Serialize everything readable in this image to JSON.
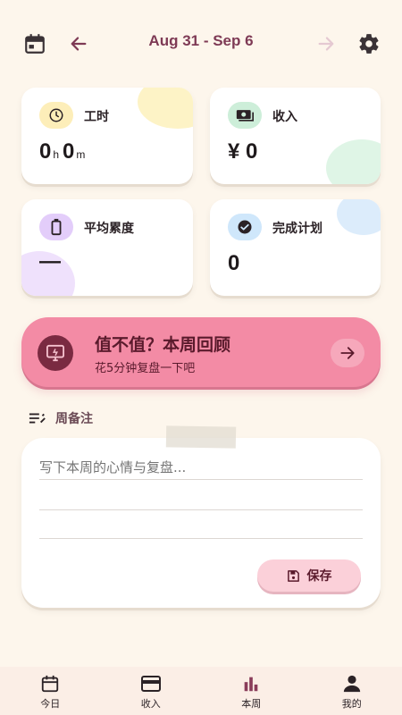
{
  "header": {
    "date_range": "Aug 31 - Sep 6",
    "icons": [
      "calendar-icon",
      "back-arrow-icon",
      "forward-arrow-icon",
      "settings-gear-icon"
    ]
  },
  "stats": {
    "hours": {
      "label": "工时",
      "hours_value": "0",
      "hours_unit": "h",
      "minutes_value": "0",
      "minutes_unit": "m",
      "icon": "clock-icon"
    },
    "income": {
      "label": "收入",
      "currency": "¥",
      "value": "0",
      "icon": "money-icon"
    },
    "fatigue": {
      "label": "平均累度",
      "value": "—",
      "icon": "battery-icon"
    },
    "plans": {
      "label": "完成计划",
      "value": "0",
      "icon": "check-circle-icon"
    }
  },
  "review": {
    "title": "值不值？本周回顾",
    "subtitle": "花5分钟复盘一下吧",
    "icon": "presentation-icon"
  },
  "notes": {
    "title": "周备注",
    "placeholder": "写下本周的心情与复盘...",
    "value": "",
    "save_label": "保存"
  },
  "nav": {
    "items": [
      {
        "label": "今日",
        "icon": "calendar-icon"
      },
      {
        "label": "收入",
        "icon": "wallet-icon"
      },
      {
        "label": "本周",
        "icon": "bar-chart-icon"
      },
      {
        "label": "我的",
        "icon": "person-icon"
      }
    ],
    "active_index": 2
  },
  "colors": {
    "background": "#fdf6ec",
    "accent_pink": "#f38ba5",
    "header_text": "#7e3a55",
    "hours_icon_bg": "#fdeeb9",
    "income_icon_bg": "#cdeed9",
    "fatigue_icon_bg": "#e3cdfa",
    "plans_icon_bg": "#cfe7fb"
  }
}
